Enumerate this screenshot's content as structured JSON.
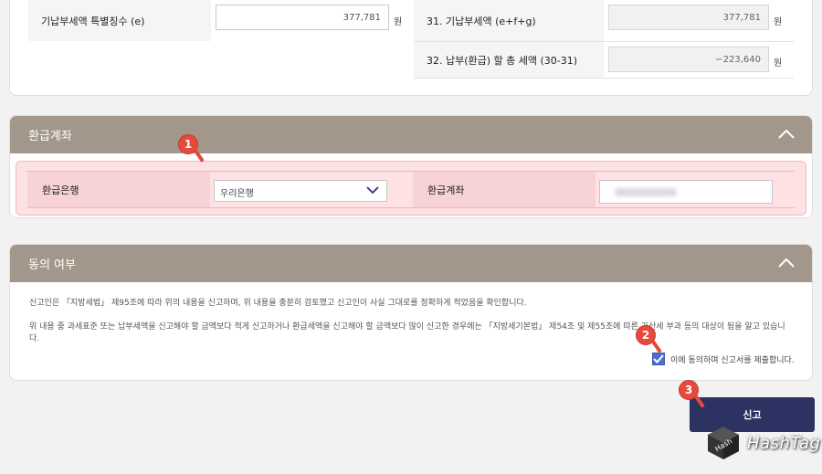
{
  "tax_summary": {
    "row_special_label": "기납부세액 특별징수 (e)",
    "row_special_value": "377,781",
    "row_31_label": "31. 기납부세액 (e+f+g)",
    "row_31_value": "377,781",
    "row_32_label": "32. 납부(환급) 할 총 세액 (30-31)",
    "row_32_value": "−223,640",
    "unit": "원"
  },
  "refund_account": {
    "title": "환급계좌",
    "bank_label": "환급은행",
    "bank_selected": "우리은행",
    "account_label": "환급계좌"
  },
  "consent": {
    "title": "동의 여부",
    "text_1": "신고인은 「지방세법」 제95조에 따라 위의 내용을 신고하며, 위 내용을 충분히 검토했고 신고인이 사실 그대로를 정확하게 적었음을 확인합니다.",
    "text_2": "위 내용 중 과세표준 또는 납부세액을 신고해야 할 금액보다 적게 신고하거나 환급세액을 신고해야 할 금액보다 많이 신고한 경우에는 「지방세기본법」 제54조 및 제55조에 따른 가산세 부과 등의 대상이 됨을 알고 있습니다.",
    "checkbox_label": "이에 동의하며 신고서를 제출합니다.",
    "checked": true
  },
  "submit_label": "신고",
  "markers": [
    "1",
    "2",
    "3"
  ],
  "watermark": "HashTag",
  "colors": {
    "section_header": "#a2978a",
    "submit": "#2c3362",
    "highlight": "#fde1e3",
    "marker": "#e74a3c",
    "checkbox": "#4a6ed1"
  }
}
